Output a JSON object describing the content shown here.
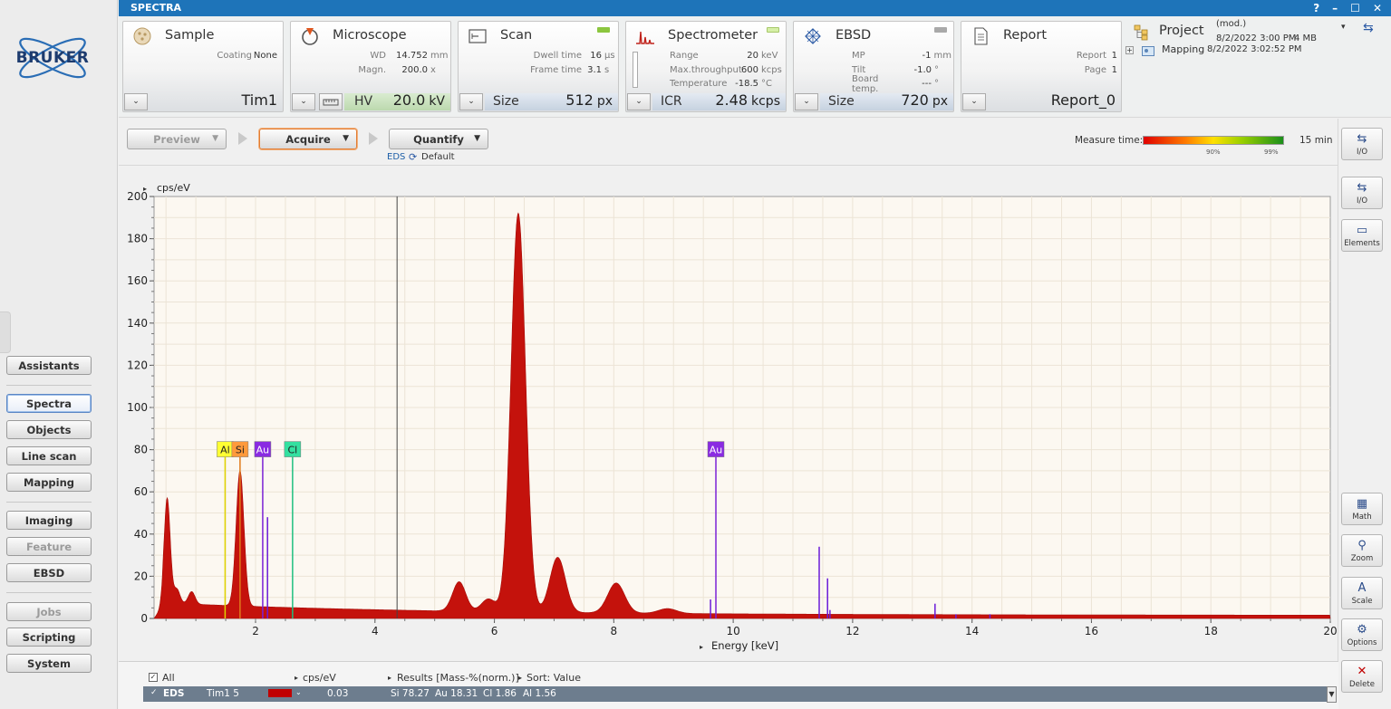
{
  "window": {
    "title": "SPECTRA",
    "controls": [
      "?",
      "–",
      "☐",
      "✕"
    ]
  },
  "brand": {
    "name": "BRUKER"
  },
  "sidebar": {
    "buttons": [
      {
        "label": "Assistants",
        "state": "normal"
      },
      {
        "label": "Spectra",
        "state": "active"
      },
      {
        "label": "Objects",
        "state": "normal"
      },
      {
        "label": "Line scan",
        "state": "normal"
      },
      {
        "label": "Mapping",
        "state": "normal"
      },
      {
        "label": "Imaging",
        "state": "normal"
      },
      {
        "label": "Feature",
        "state": "disabled"
      },
      {
        "label": "EBSD",
        "state": "normal"
      },
      {
        "label": "Jobs",
        "state": "disabled"
      },
      {
        "label": "Scripting",
        "state": "normal"
      },
      {
        "label": "System",
        "state": "normal"
      }
    ]
  },
  "panels": {
    "sample": {
      "title": "Sample",
      "coating_label": "Coating",
      "coating_value": "None",
      "name": "Tim1",
      "dropdown": "⌄"
    },
    "microscope": {
      "title": "Microscope",
      "wd_label": "WD",
      "wd_value": "14.752",
      "wd_unit": "mm",
      "magn_label": "Magn.",
      "magn_value": "200.0",
      "magn_unit": "x",
      "hv_label": "HV",
      "hv_value": "20.0",
      "hv_unit": "kV",
      "dropdown": "⌄"
    },
    "scan": {
      "title": "Scan",
      "dwell_label": "Dwell time",
      "dwell_value": "16",
      "dwell_unit": "µs",
      "frame_label": "Frame time",
      "frame_value": "3.1",
      "frame_unit": "s",
      "size_label": "Size",
      "size_value": "512",
      "size_unit": "px",
      "dropdown": "⌄"
    },
    "spectrometer": {
      "title": "Spectrometer",
      "range_label": "Range",
      "range_value": "20",
      "range_unit": "keV",
      "thru_label": "Max.throughput",
      "thru_value": "600",
      "thru_unit": "kcps",
      "temp_label": "Temperature",
      "temp_value": "-18.5",
      "temp_unit": "°C",
      "icr_label": "ICR",
      "icr_value": "2.48",
      "icr_unit": "kcps",
      "dropdown": "⌄"
    },
    "ebsd": {
      "title": "EBSD",
      "mp_label": "MP",
      "mp_value": "-1",
      "mp_unit": "mm",
      "tilt_label": "Tilt",
      "tilt_value": "-1.0",
      "tilt_unit": "°",
      "board_label": "Board temp.",
      "board_value": "---",
      "board_unit": "°",
      "size_label": "Size",
      "size_value": "720",
      "size_unit": "px",
      "dropdown": "⌄"
    },
    "report": {
      "title": "Report",
      "report_label": "Report",
      "report_value": "1",
      "page_label": "Page",
      "page_value": "1",
      "name": "Report_0",
      "dropdown": "⌄"
    }
  },
  "project": {
    "title": "Project",
    "modified": "(mod.)",
    "date": "8/2/2022 3:00 PM",
    "size": "4 MB",
    "child_label": "Mapping",
    "child_date": "8/2/2022 3:02:52 PM"
  },
  "toolbar": {
    "preview_label": "Preview",
    "acquire_label": "Acquire",
    "quantify_label": "Quantify",
    "mode_label": "EDS",
    "method_label": "Default",
    "measure_label": "Measure time:",
    "measure_value": "15 min",
    "tick_90": "90%",
    "tick_99": "99%"
  },
  "side_tools": {
    "io_top": "I/O",
    "io": "I/O",
    "elements": "Elements",
    "math": "Math",
    "zoom": "Zoom",
    "scale": "Scale",
    "scale_icon": "A",
    "options": "Options",
    "delete": "Delete"
  },
  "chart_data": {
    "type": "area",
    "xlabel": "Energy [keV]",
    "ylabel": "cps/eV",
    "xlim": [
      0.3,
      20
    ],
    "ylim": [
      0,
      200
    ],
    "xticks": [
      2,
      4,
      6,
      8,
      10,
      12,
      14,
      16,
      18,
      20
    ],
    "yticks": [
      0,
      20,
      40,
      60,
      80,
      100,
      120,
      140,
      160,
      180,
      200
    ],
    "grid": true,
    "cursor_x": 4.37,
    "peaks": [
      {
        "x": 0.52,
        "y": 52
      },
      {
        "x": 0.68,
        "y": 9
      },
      {
        "x": 0.93,
        "y": 8
      },
      {
        "x": 1.74,
        "y": 66
      },
      {
        "x": 5.41,
        "y": 15
      },
      {
        "x": 5.9,
        "y": 7
      },
      {
        "x": 6.4,
        "y": 190
      },
      {
        "x": 7.06,
        "y": 27
      },
      {
        "x": 8.04,
        "y": 15
      },
      {
        "x": 8.9,
        "y": 3
      }
    ],
    "element_markers": [
      {
        "label": "Al",
        "x": 1.49,
        "color": "#ffff33",
        "line": "#e0d200"
      },
      {
        "label": "Si",
        "x": 1.74,
        "color": "#ff9a3c",
        "line": "#e07b1c"
      },
      {
        "label": "Au",
        "x": 2.12,
        "color": "#8a2be2",
        "line": "#7b22d6"
      },
      {
        "label": "Cl",
        "x": 2.62,
        "color": "#33e0a0",
        "line": "#1fbf80"
      },
      {
        "label": "Au",
        "x": 9.71,
        "color": "#8a2be2",
        "line": "#7b22d6"
      }
    ],
    "line_markers": [
      {
        "x": 2.2,
        "y": 48
      },
      {
        "x": 9.62,
        "y": 9
      },
      {
        "x": 11.44,
        "y": 34
      },
      {
        "x": 11.58,
        "y": 19
      },
      {
        "x": 11.62,
        "y": 4
      },
      {
        "x": 13.38,
        "y": 7
      },
      {
        "x": 13.73,
        "y": 2
      },
      {
        "x": 14.3,
        "y": 2
      }
    ]
  },
  "results": {
    "all_label": "All",
    "unit_label": "cps/eV",
    "results_label": "Results [Mass-%(norm.)]",
    "sort_label": "Sort: Value",
    "row": {
      "type": "EDS",
      "name": "Tim1 5",
      "value": "0.03",
      "si": "Si 78.27",
      "au": "Au 18.31",
      "cl": "Cl 1.86",
      "al": "Al 1.56"
    }
  }
}
